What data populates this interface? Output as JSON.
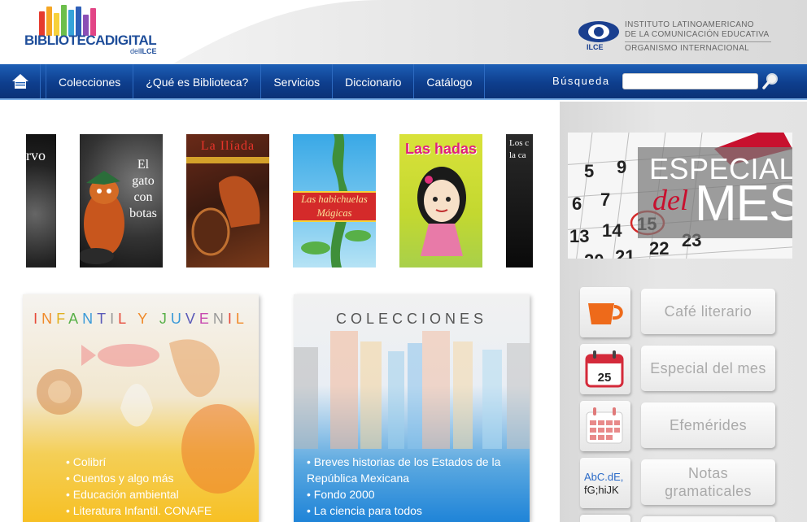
{
  "header": {
    "logo": {
      "title_main": "BIBLIOTECADIGITAL",
      "title_sub_prefix": "del",
      "title_sub": "ILCE",
      "book_colors": [
        "#e63b2e",
        "#f5a623",
        "#f7d13c",
        "#6cbf4b",
        "#36a3d9",
        "#2e5fb8",
        "#8a4fb5",
        "#e24586"
      ]
    },
    "institution": {
      "abbr": "ILCE",
      "line1": "INSTITUTO LATINOAMERICANO",
      "line2": "DE LA COMUNICACIÓN EDUCATIVA",
      "line3": "ORGANISMO INTERNACIONAL"
    }
  },
  "nav": {
    "home_icon": "home-icon",
    "items": [
      {
        "label": "Colecciones"
      },
      {
        "label": "¿Qué es Biblioteca?"
      },
      {
        "label": "Servicios"
      },
      {
        "label": "Diccionario"
      },
      {
        "label": "Catálogo"
      }
    ],
    "search": {
      "label": "Búsqueda",
      "value": "",
      "icon": "magnifier-icon"
    }
  },
  "carousel": {
    "covers": [
      {
        "title": "rvo"
      },
      {
        "title": "El gato con botas",
        "lines": [
          "El",
          "gato",
          "con",
          "botas"
        ]
      },
      {
        "title": "La Ilíada"
      },
      {
        "title": "Las habichuelas Mágicas",
        "lines": [
          "Las habichuelas",
          "Mágicas"
        ]
      },
      {
        "title": "Las hadas"
      },
      {
        "title": "Los c… la ca…",
        "lines": [
          "Los c",
          "la ca"
        ]
      }
    ]
  },
  "banner": {
    "line1": "ESPECIAL",
    "line2": "del",
    "line3": "MES",
    "calendar_numbers": [
      "6",
      "7",
      "13",
      "14",
      "15",
      "20",
      "21",
      "22",
      "23",
      "9",
      "5"
    ]
  },
  "side_links": [
    {
      "label": "Café literario",
      "icon": "coffee-cup-icon"
    },
    {
      "label": "Especial del mes",
      "icon": "calendar-25-icon",
      "icon_text": "25"
    },
    {
      "label": "Efemérides",
      "icon": "calendar-grid-icon"
    },
    {
      "label": "Notas gramaticales",
      "icon": "letters-icon",
      "icon_text1": "AbC.dE,",
      "icon_text2": "fG;hiJK"
    }
  ],
  "sections": {
    "infantil": {
      "title": "INFANTIL Y JUVENIL",
      "title_colors": [
        "#e64a3a",
        "#f08a2a",
        "#e0b020",
        "#58b048",
        "#3a9ad8",
        "#5a5ab8",
        "#999999",
        "#e64a3a",
        "#f08a2a",
        "#58b048",
        "#3a9ad8",
        "#5a5ab8",
        "#c84ab0",
        "#999999",
        "#e64a3a",
        "#f08a2a",
        "#58b048",
        "#3a9ad8"
      ],
      "items": [
        "Colibrí",
        "Cuentos y algo más",
        "Educación ambiental",
        "Literatura Infantil. CONAFE"
      ]
    },
    "colecciones": {
      "title": "COLECCIONES",
      "items": [
        "Breves historias de los Estados de la República Mexicana",
        "Fondo 2000",
        "La ciencia para todos"
      ]
    }
  }
}
